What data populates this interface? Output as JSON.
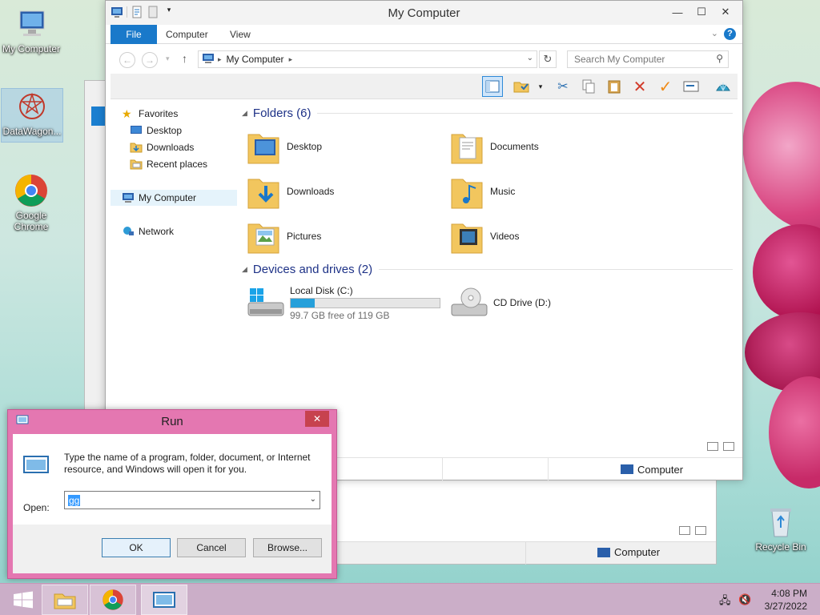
{
  "desktop": {
    "icons": [
      {
        "label": "My Computer"
      },
      {
        "label": "DataWagon..."
      },
      {
        "label": "Google Chrome"
      },
      {
        "label": "Recycle Bin"
      }
    ]
  },
  "explorer": {
    "title": "My Computer",
    "tabs": {
      "file": "File",
      "computer": "Computer",
      "view": "View"
    },
    "address": {
      "crumb": "My Computer"
    },
    "search_placeholder": "Search My Computer",
    "nav": {
      "favorites": "Favorites",
      "desktop": "Desktop",
      "downloads": "Downloads",
      "recent": "Recent places",
      "computer": "My Computer",
      "network": "Network"
    },
    "folders_header": "Folders (6)",
    "folders": [
      {
        "label": "Desktop"
      },
      {
        "label": "Documents"
      },
      {
        "label": "Downloads"
      },
      {
        "label": "Music"
      },
      {
        "label": "Pictures"
      },
      {
        "label": "Videos"
      }
    ],
    "drives_header": "Devices and drives (2)",
    "drives": {
      "c": {
        "label": "Local Disk (C:)",
        "free": "99.7 GB free of 119 GB",
        "used_fraction": 0.16
      },
      "d": {
        "label": "CD Drive (D:)"
      }
    },
    "status_computer": "Computer"
  },
  "bg_status_computer": "Computer",
  "run": {
    "title": "Run",
    "description": "Type the name of a program, folder, document, or Internet resource, and Windows will open it for you.",
    "open_label": "Open:",
    "open_value": "gg",
    "ok": "OK",
    "cancel": "Cancel",
    "browse": "Browse..."
  },
  "taskbar": {
    "time": "4:08 PM",
    "date": "3/27/2022"
  },
  "colors": {
    "accent": "#1979ca",
    "run_frame": "#e477b1",
    "progress": "#26a0da"
  }
}
